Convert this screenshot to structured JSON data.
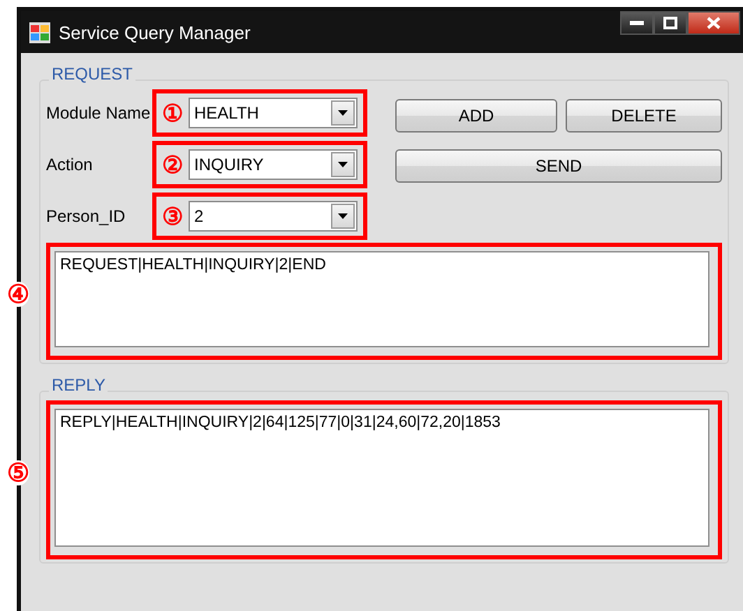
{
  "window": {
    "title": "Service Query Manager"
  },
  "request": {
    "title": "REQUEST",
    "fields": [
      {
        "label": "Module Name",
        "value": "HEALTH",
        "marker": "①"
      },
      {
        "label": "Action",
        "value": "INQUIRY",
        "marker": "②"
      },
      {
        "label": "Person_ID",
        "value": "2",
        "marker": "③"
      }
    ],
    "buttons": [
      {
        "label": "ADD"
      },
      {
        "label": "DELETE"
      },
      {
        "label": "SEND"
      }
    ],
    "message": {
      "text": "REQUEST|HEALTH|INQUIRY|2|END",
      "marker": "④"
    }
  },
  "reply": {
    "title": "REPLY",
    "message": {
      "text": "REPLY|HEALTH|INQUIRY|2|64|125|77|0|31|24,60|72,20|1853",
      "marker": "⑤"
    }
  }
}
